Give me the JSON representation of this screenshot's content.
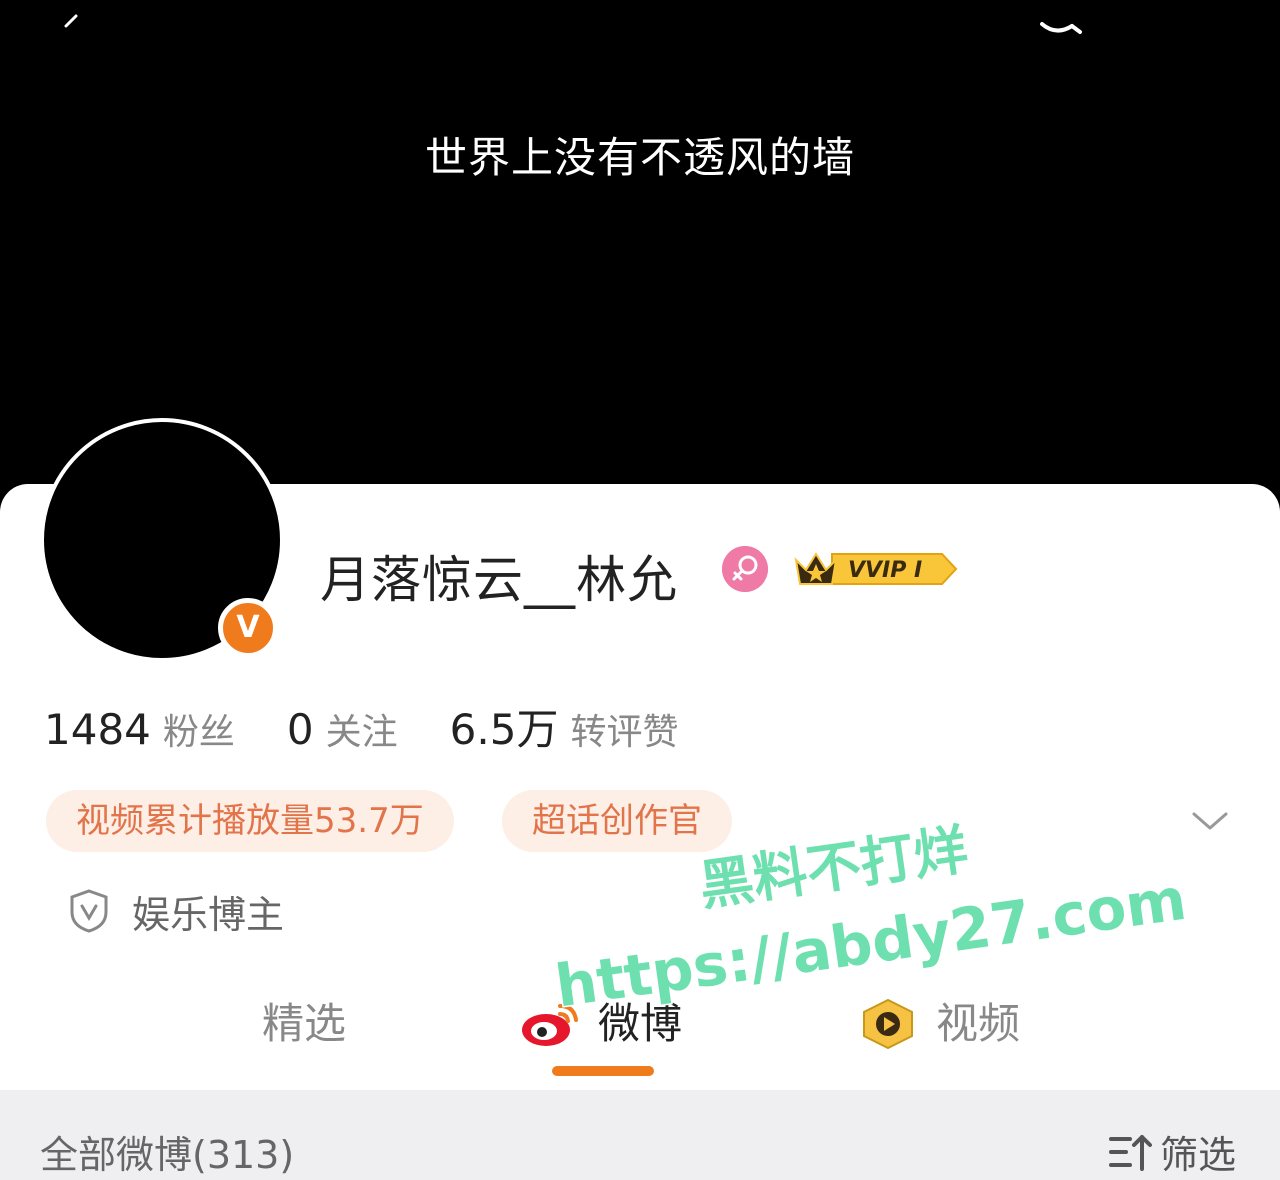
{
  "banner": {
    "text": "世界上没有不透风的墙"
  },
  "profile": {
    "username": "月落惊云__林允",
    "vvip_label": "VVIP I",
    "verified_glyph": "V"
  },
  "stats": [
    {
      "value": "1484",
      "label": "粉丝"
    },
    {
      "value": "0",
      "label": "关注"
    },
    {
      "value": "6.5万",
      "label": "转评赞"
    }
  ],
  "tags": [
    "视频累计播放量53.7万",
    "超话创作官"
  ],
  "category": "娱乐博主",
  "tabs": {
    "featured": "精选",
    "weibo": "微博",
    "video": "视频"
  },
  "feed": {
    "title": "全部微博(313)",
    "filter": "筛选"
  },
  "watermark": {
    "line1": "黑料不打烊",
    "line2": "https://abdy27.com"
  },
  "colors": {
    "accent": "#f07b1d",
    "tag_bg": "#fdeee6",
    "tag_text": "#e2744a",
    "watermark": "#6ee0b0"
  },
  "icons": [
    "back-icon",
    "search-icon",
    "gender-female-icon",
    "vvip-crown-icon",
    "verified-icon",
    "chevron-down-icon",
    "shield-icon",
    "weibo-logo-icon",
    "video-icon",
    "filter-icon"
  ]
}
